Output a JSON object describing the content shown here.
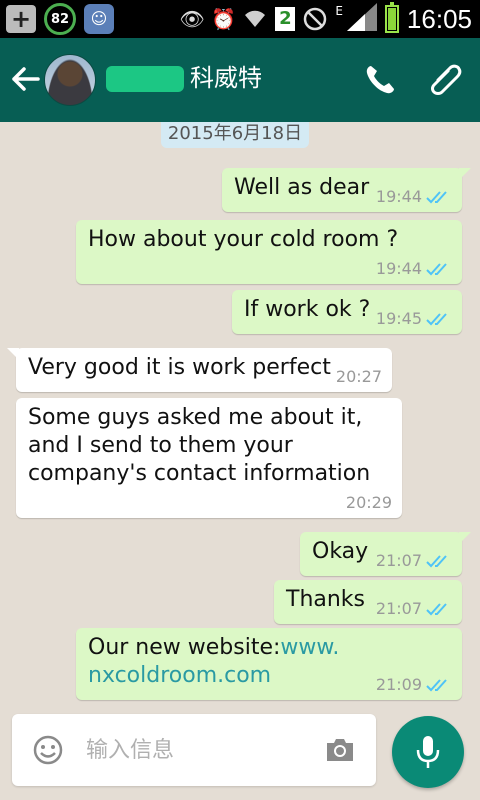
{
  "status_bar": {
    "badge_value": "82",
    "notification_count": "2",
    "network_type": "E",
    "time": "16:05"
  },
  "header": {
    "contact_name": "科威特"
  },
  "chat": {
    "date": "2015年6月18日",
    "messages": [
      {
        "direction": "out",
        "text": "Well as dear",
        "time": "19:44"
      },
      {
        "direction": "out",
        "text": "How about your cold room ?",
        "time": "19:44"
      },
      {
        "direction": "out",
        "text": "If work ok ?",
        "time": "19:45"
      },
      {
        "direction": "in",
        "text": "Very good it is work perfect",
        "time": "20:27"
      },
      {
        "direction": "in",
        "text_lines": [
          "Some guys asked me about it,",
          "and I send to them your",
          "company's contact information"
        ],
        "time": "20:29"
      },
      {
        "direction": "out",
        "text": "Okay",
        "time": "21:07"
      },
      {
        "direction": "out",
        "text": "Thanks",
        "time": "21:07"
      },
      {
        "direction": "out",
        "text_prefix": "Our new website:",
        "link_part1": "www.",
        "link_part2": "nxcoldroom.com",
        "time": "21:09"
      }
    ]
  },
  "input": {
    "placeholder": "输入信息"
  },
  "colors": {
    "header": "#075e54",
    "outgoing_bubble": "#dcf8c6",
    "incoming_bubble": "#ffffff",
    "read_tick": "#4fc3f7",
    "link": "#2a9aa3",
    "mic_button": "#0a8a76"
  },
  "icons": [
    "back-arrow-icon",
    "phone-icon",
    "paperclip-icon",
    "emoji-icon",
    "camera-icon",
    "mic-icon",
    "double-tick-icon"
  ]
}
